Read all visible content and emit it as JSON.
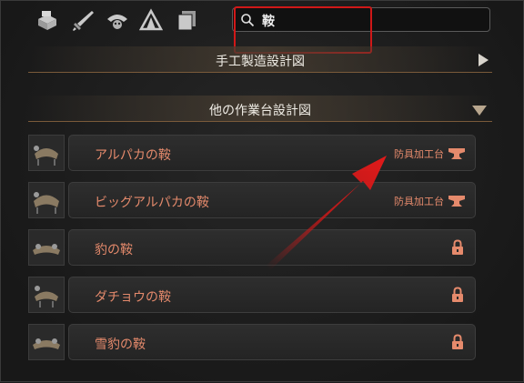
{
  "search": {
    "value": "鞍"
  },
  "top_icons": [
    "materials-icon",
    "weapons-icon",
    "pal-gear-icon",
    "camp-icon",
    "items-icon"
  ],
  "sections": {
    "handcraft": {
      "title": "手工製造設計図",
      "expanded": false
    },
    "other_workbench": {
      "title": "他の作業台設計図",
      "expanded": true
    }
  },
  "items": [
    {
      "label": "アルパカの鞍",
      "station": "防具加工台",
      "locked": false
    },
    {
      "label": "ビッグアルパカの鞍",
      "station": "防具加工台",
      "locked": false
    },
    {
      "label": "豹の鞍",
      "station": "",
      "locked": true
    },
    {
      "label": "ダチョウの鞍",
      "station": "",
      "locked": true
    },
    {
      "label": "雪豹の鞍",
      "station": "",
      "locked": true
    }
  ],
  "colors": {
    "accent": "#e58a6c",
    "highlight": "#d01818"
  }
}
